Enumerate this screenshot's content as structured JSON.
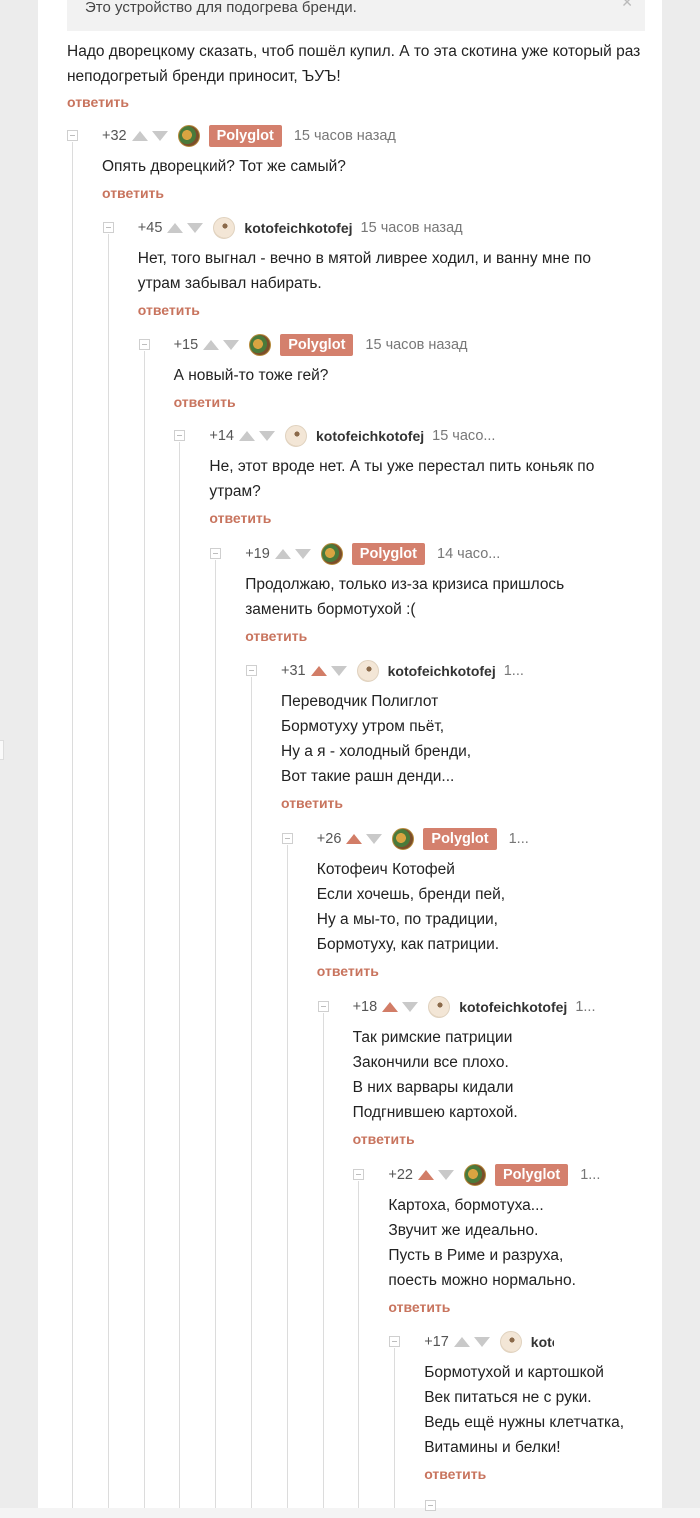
{
  "quote": {
    "text": "Это устройство для подогрева бренди."
  },
  "root": {
    "text": "Надо дворецкому сказать, чтоб пошёл купил. А то эта скотина уже который раз неподогретый бренди приносит, ЪУЪ!",
    "reply_label": "ответить"
  },
  "comments": [
    {
      "rating": "+32",
      "user": "Polyglot",
      "time": "15 часов назад",
      "lines": [
        "Опять дворецкий? Тот же самый?"
      ],
      "reply": "ответить",
      "up_active": false
    },
    {
      "rating": "+45",
      "user": "kotofeichkotofej",
      "time": "15 часов назад",
      "lines": [
        "Нет, того выгнал - вечно в мятой ливрее ходил, и ванну мне по",
        "утрам забывал набирать."
      ],
      "reply": "ответить",
      "up_active": false
    },
    {
      "rating": "+15",
      "user": "Polyglot",
      "time": "15 часов назад",
      "lines": [
        "А новый-то тоже гей?"
      ],
      "reply": "ответить",
      "up_active": false
    },
    {
      "rating": "+14",
      "user": "kotofeichkotofej",
      "time": "15 часо...",
      "lines": [
        "Не, этот вроде нет. А ты уже перестал пить коньяк по",
        "утрам?"
      ],
      "reply": "ответить",
      "up_active": false
    },
    {
      "rating": "+19",
      "user": "Polyglot",
      "time": "14 часо...",
      "lines": [
        "Продолжаю, только из-за кризиса пришлось",
        "заменить бормотухой :("
      ],
      "reply": "ответить",
      "up_active": false
    },
    {
      "rating": "+31",
      "user": "kotofeichkotofej",
      "time": "1...",
      "lines": [
        "Переводчик Полиглот",
        "Бормотуху утром пьёт,",
        "Ну а я - холодный бренди,",
        "Вот такие рашн денди..."
      ],
      "reply": "ответить",
      "up_active": true
    },
    {
      "rating": "+26",
      "user": "Polyglot",
      "time": "1...",
      "lines": [
        "Котофеич Котофей",
        "Если хочешь, бренди пей,",
        "Ну а мы-то, по традиции,",
        "Бормотуху, как патриции."
      ],
      "reply": "ответить",
      "up_active": true
    },
    {
      "rating": "+18",
      "user": "kotofeichkotofej",
      "time": "1...",
      "lines": [
        "Так римские патриции",
        "Закончили все плохо.",
        "В них варвары кидали",
        "Подгнившею картохой."
      ],
      "reply": "ответить",
      "up_active": true
    },
    {
      "rating": "+22",
      "user": "Polyglot",
      "time": "1...",
      "lines": [
        "Картоха, бормотуха...",
        "Звучит же идеально.",
        "Пусть в Риме и разруха,",
        "поесть можно нормально."
      ],
      "reply": "ответить",
      "up_active": true
    },
    {
      "rating": "+17",
      "user": "kotofeichkotofej",
      "time": "",
      "lines": [
        "Бормотухой и картошкой",
        "Век питаться не с руки.",
        "Ведь ещё нужны клетчатка,",
        "Витамины и белки!"
      ],
      "reply": "ответить",
      "up_active": false
    }
  ],
  "colors": {
    "badge": "#d4806d",
    "reply": "#c8745e",
    "arrow_active": "#d27d67",
    "arrow_idle": "#c9c9c9"
  }
}
